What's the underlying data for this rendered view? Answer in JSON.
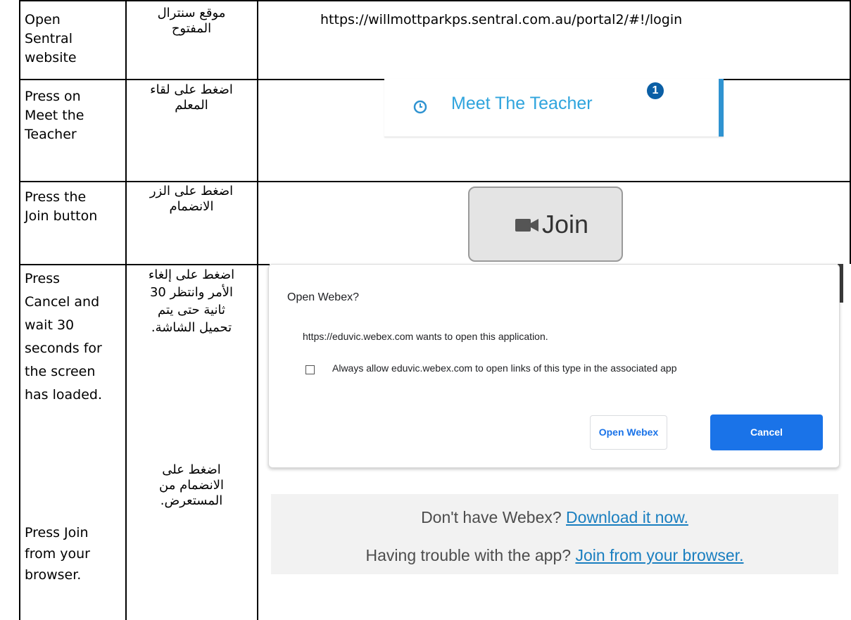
{
  "rows": [
    {
      "english": "Open\nSentral\nwebsite",
      "arabic": "موقع سنترال\nالمفتوح"
    },
    {
      "english": "Press on\nMeet the\nTeacher",
      "arabic": "اضغط على لقاء\nالمعلم"
    },
    {
      "english": "Press the\nJoin button",
      "arabic": "اضغط على الزر\nالانضمام"
    },
    {
      "english": "Press\nCancel and\nwait 30\nseconds for\nthe screen\nhas loaded.",
      "arabic": "اضغط على إلغاء\nالأمر وانتظر 30\nثانية حتى يتم\nتحميل الشاشة."
    },
    {
      "english": "Press Join\nfrom your\nbrowser.",
      "arabic": "اضغط على\nالانضمام من\nالمستعرض."
    }
  ],
  "url": "https://willmottparkps.sentral.com.au/portal2/#!/login",
  "meet_teacher": {
    "label": "Meet The Teacher",
    "badge": "1",
    "accent": "#2f93d1",
    "icon": "clock-icon"
  },
  "join_button": {
    "label": "Join",
    "icon": "video-camera-icon"
  },
  "dialog": {
    "title": "Open Webex?",
    "message": "https://eduvic.webex.com wants to open this application.",
    "checkbox_label": "Always allow eduvic.webex.com to open links of this type in the associated app",
    "checkbox_checked": false,
    "open_label": "Open Webex",
    "cancel_label": "Cancel",
    "primary_color": "#1a73e8"
  },
  "webex_panel": {
    "line1_text": "Don't have Webex? ",
    "line1_link": "Download it now.",
    "line2_text": "Having trouble with the app? ",
    "line2_link": "Join from your browser."
  }
}
